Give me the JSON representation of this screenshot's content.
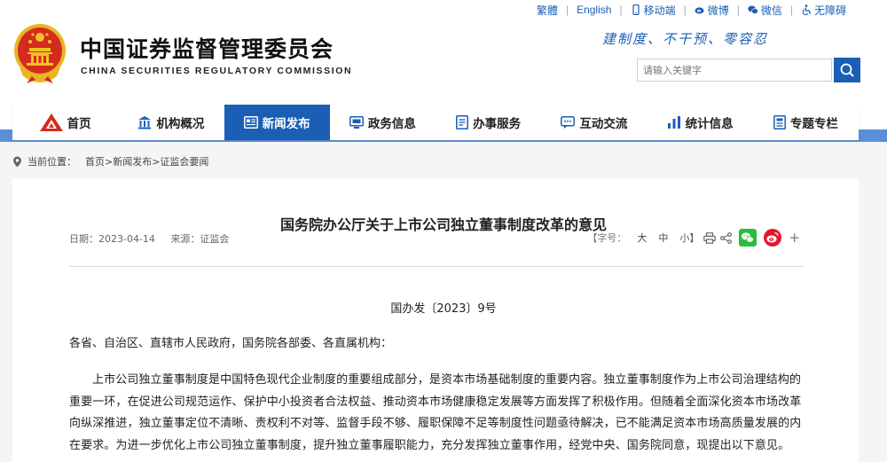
{
  "topbar": {
    "traditional": "繁體",
    "english": "English",
    "mobile": "移动端",
    "weibo": "微博",
    "wechat": "微信",
    "accessibility": "无障碍"
  },
  "site": {
    "cn_name": "中国证券监督管理委员会",
    "en_name": "CHINA SECURITIES REGULATORY COMMISSION",
    "motto": "建制度、不干预、零容忍"
  },
  "search": {
    "placeholder": "请输入关键字"
  },
  "nav": {
    "items": [
      {
        "label": "首页",
        "icon": "home-icon"
      },
      {
        "label": "机构概况",
        "icon": "building-icon"
      },
      {
        "label": "新闻发布",
        "icon": "news-icon",
        "active": true
      },
      {
        "label": "政务信息",
        "icon": "monitor-icon"
      },
      {
        "label": "办事服务",
        "icon": "document-icon"
      },
      {
        "label": "互动交流",
        "icon": "chat-icon"
      },
      {
        "label": "统计信息",
        "icon": "stats-icon"
      },
      {
        "label": "专题专栏",
        "icon": "topic-icon"
      }
    ]
  },
  "breadcrumb": {
    "label": "当前位置：",
    "path": "首页>新闻发布>证监会要闻"
  },
  "article": {
    "title": "国务院办公厅关于上市公司独立董事制度改革的意见",
    "date": "日期：2023-04-14",
    "source": "来源：证监会",
    "font_size_label": "【字号：",
    "size_large": "大",
    "size_medium": "中",
    "size_small": "小】",
    "doc_number": "国办发〔2023〕9号",
    "salutation": "各省、自治区、直辖市人民政府，国务院各部委、各直属机构：",
    "paragraph": "上市公司独立董事制度是中国特色现代企业制度的重要组成部分，是资本市场基础制度的重要内容。独立董事制度作为上市公司治理结构的重要一环，在促进公司规范运作、保护中小投资者合法权益、推动资本市场健康稳定发展等方面发挥了积极作用。但随着全面深化资本市场改革向纵深推进，独立董事定位不清晰、责权利不对等、监督手段不够、履职保障不足等制度性问题亟待解决，已不能满足资本市场高质量发展的内在要求。为进一步优化上市公司独立董事制度，提升独立董事履职能力，充分发挥独立董事作用，经党中央、国务院同意，现提出以下意见。"
  },
  "colors": {
    "brand_blue": "#1a5fb4",
    "stripe_blue": "#5b8fd8",
    "emblem_red": "#d42b1e",
    "emblem_gold": "#f2c028",
    "wechat_green": "#2dbb3f",
    "weibo_red": "#e6162d"
  }
}
